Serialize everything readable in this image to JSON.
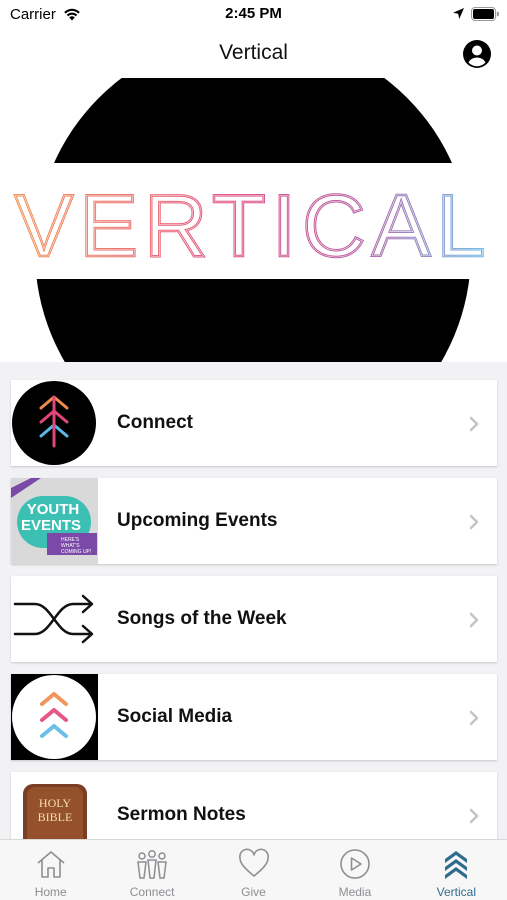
{
  "status_bar": {
    "carrier": "Carrier",
    "time": "2:45 PM"
  },
  "nav": {
    "title": "Vertical"
  },
  "banner": {
    "logo_text": "VERTICAL"
  },
  "list": {
    "items": [
      {
        "label": "Connect"
      },
      {
        "label": "Upcoming Events",
        "thumb_text": [
          "YOUTH",
          "EVENTS",
          "HERE'S",
          "WHAT'S",
          "COMING UP!"
        ]
      },
      {
        "label": "Songs of the Week"
      },
      {
        "label": "Social Media"
      },
      {
        "label": "Sermon Notes",
        "thumb_text": [
          "HOLY",
          "BIBLE"
        ]
      }
    ]
  },
  "tabs": [
    {
      "label": "Home",
      "icon": "home-icon"
    },
    {
      "label": "Connect",
      "icon": "people-icon"
    },
    {
      "label": "Give",
      "icon": "heart-icon"
    },
    {
      "label": "Media",
      "icon": "play-icon"
    },
    {
      "label": "Vertical",
      "icon": "chevrons-up-icon"
    }
  ],
  "colors": {
    "accent": "#2f6b8e",
    "tab_inactive": "#8e8e93",
    "logo_orange": "#f08a4b",
    "logo_pink": "#e0457b",
    "logo_blue": "#5bb8e6"
  }
}
